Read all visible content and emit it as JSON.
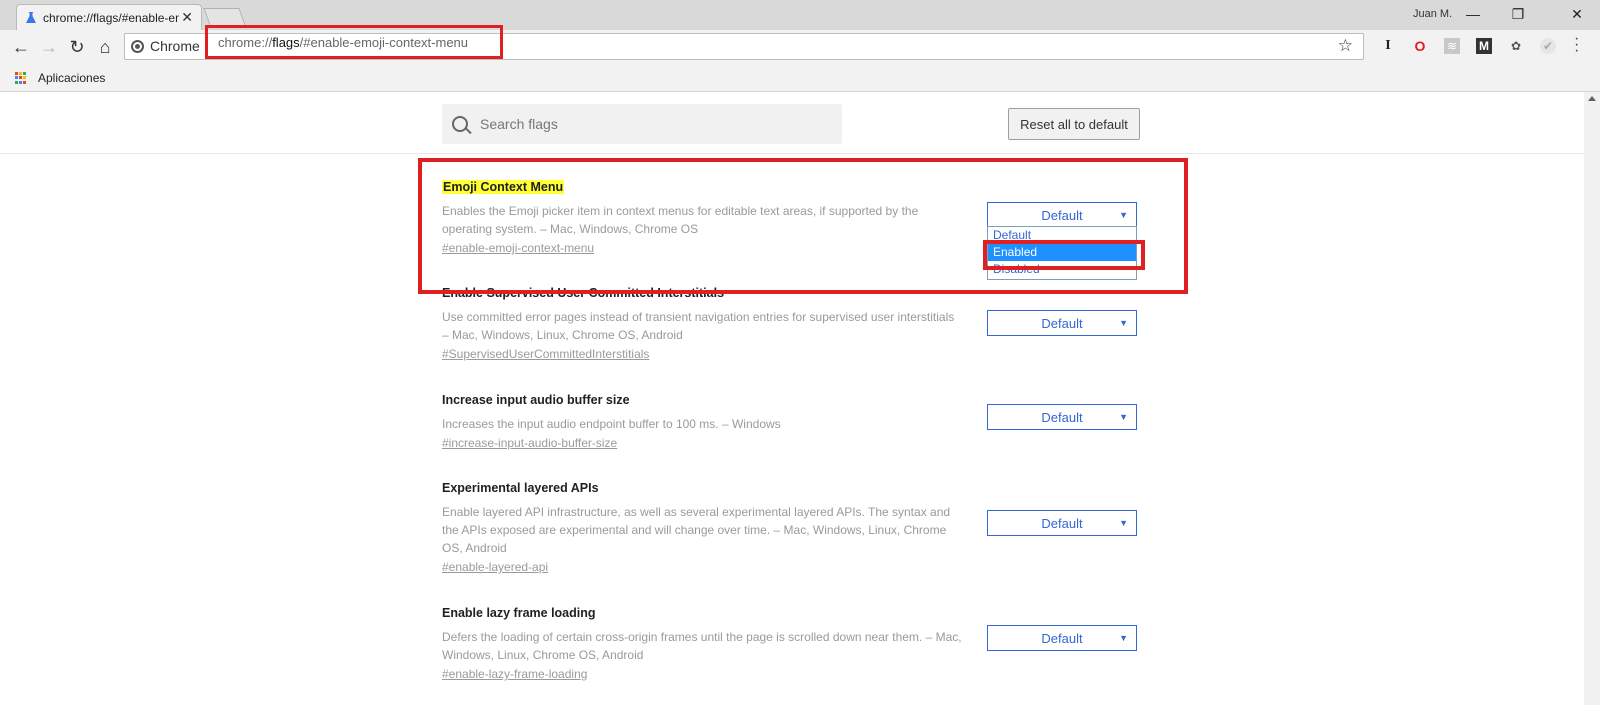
{
  "browser": {
    "tab_title": "chrome://flags/#enable-emoji-context-menu",
    "user_name": "Juan M.",
    "window_minimize": "—",
    "window_restore": "❐",
    "window_close": "✕",
    "tab_close": "✕",
    "back": "←",
    "forward": "→",
    "reload": "↻",
    "home": "⌂",
    "security_label": "Chrome",
    "url_prefix": "chrome://",
    "url_host": "flags",
    "url_path": "/#enable-emoji-context-menu",
    "bookmark_star": "☆",
    "bookmarks_apps_label": "Aplicaciones",
    "extensions": [
      "I",
      "O",
      "≋",
      "M",
      "✿",
      "✔"
    ]
  },
  "flags": {
    "search_placeholder": "Search flags",
    "reset_label": "Reset all to default",
    "experiments": [
      {
        "name": "Emoji Context Menu",
        "description": "Enables the Emoji picker item in context menus for editable text areas, if supported by the operating system. – Mac, Windows, Chrome OS",
        "link": "#enable-emoji-context-menu",
        "value": "Default"
      },
      {
        "name": "Enable Supervised User Committed Interstitials",
        "description": "Use committed error pages instead of transient navigation entries for supervised user interstitials – Mac, Windows, Linux, Chrome OS, Android",
        "link": "#SupervisedUserCommittedInterstitials",
        "value": "Default"
      },
      {
        "name": "Increase input audio buffer size",
        "description": "Increases the input audio endpoint buffer to 100 ms. – Windows",
        "link": "#increase-input-audio-buffer-size",
        "value": "Default"
      },
      {
        "name": "Experimental layered APIs",
        "description": "Enable layered API infrastructure, as well as several experimental layered APIs. The syntax and the APIs exposed are experimental and will change over time. – Mac, Windows, Linux, Chrome OS, Android",
        "link": "#enable-layered-api",
        "value": "Default"
      },
      {
        "name": "Enable lazy frame loading",
        "description": "Defers the loading of certain cross-origin frames until the page is scrolled down near them. – Mac, Windows, Linux, Chrome OS, Android",
        "link": "#enable-lazy-frame-loading",
        "value": "Default"
      }
    ],
    "dropdown_options": [
      "Default",
      "Enabled",
      "Disabled"
    ],
    "dropdown_selected": "Enabled"
  },
  "colors": {
    "accent_blue": "#3367d6",
    "highlight_yellow": "#ffff33",
    "annotation_red": "#e02020"
  }
}
